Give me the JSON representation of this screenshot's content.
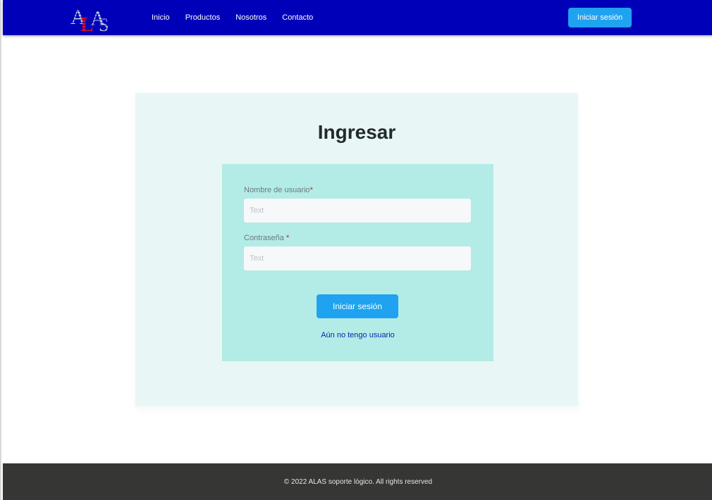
{
  "header": {
    "logo_text": "ALAS",
    "nav": [
      "Inicio",
      "Productos",
      "Nosotros",
      "Contacto"
    ],
    "login_label": "Iniciar sesión"
  },
  "login_card": {
    "title": "Ingresar",
    "username": {
      "label": "Nombre de usuario",
      "required_mark": "*",
      "placeholder": "Text",
      "value": ""
    },
    "password": {
      "label": "Contraseña ",
      "required_mark": "*",
      "placeholder": "Text",
      "value": ""
    },
    "submit_label": "Iniciar sesión",
    "register_link": "Aún no tengo usuario"
  },
  "footer": {
    "text": "© 2022 ALAS soporte lógico. All rights reserved"
  },
  "colors": {
    "navbar": "#0000b8",
    "accent_button": "#1fa2f0",
    "card_bg": "#e8f7f6",
    "form_bg": "#b3ece6",
    "link": "#0a1fb0",
    "footer_bg": "#363634",
    "required": "#e0141e"
  }
}
